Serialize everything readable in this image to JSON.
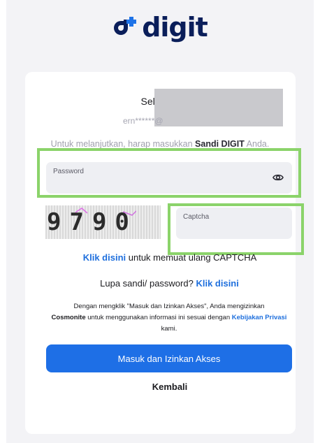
{
  "logo": {
    "text": "digit",
    "brand_color": "#0a1e5a",
    "accent_color": "#1e73e8"
  },
  "welcome": {
    "greeting": "Selamat datang,",
    "email_masked": "ern******@"
  },
  "instruction": {
    "prefix": "Untuk melanjutkan, harap masukkan",
    "bold": "Sandi DIGIT",
    "suffix": "Anda."
  },
  "password": {
    "label": "Password",
    "icon": "eye-icon"
  },
  "captcha": {
    "image_text": "9790",
    "label": "Captcha"
  },
  "reload": {
    "link": "Klik disini",
    "text": "untuk memuat ulang CAPTCHA"
  },
  "forgot": {
    "text": "Lupa sandi/ password?",
    "link": "Klik disini"
  },
  "consent": {
    "part1": "Dengan mengklik \"Masuk dan Izinkan Akses\", Anda mengizinkan",
    "company": "Cosmonite",
    "part2": "untuk menggunakan informasi ini sesuai dengan",
    "policy_link": "Kebijakan Privasi",
    "part3": "kami."
  },
  "submit_label": "Masuk dan Izinkan Akses",
  "back_label": "Kembali",
  "colors": {
    "primary": "#1e6fe6",
    "highlight": "#8bd36a"
  }
}
